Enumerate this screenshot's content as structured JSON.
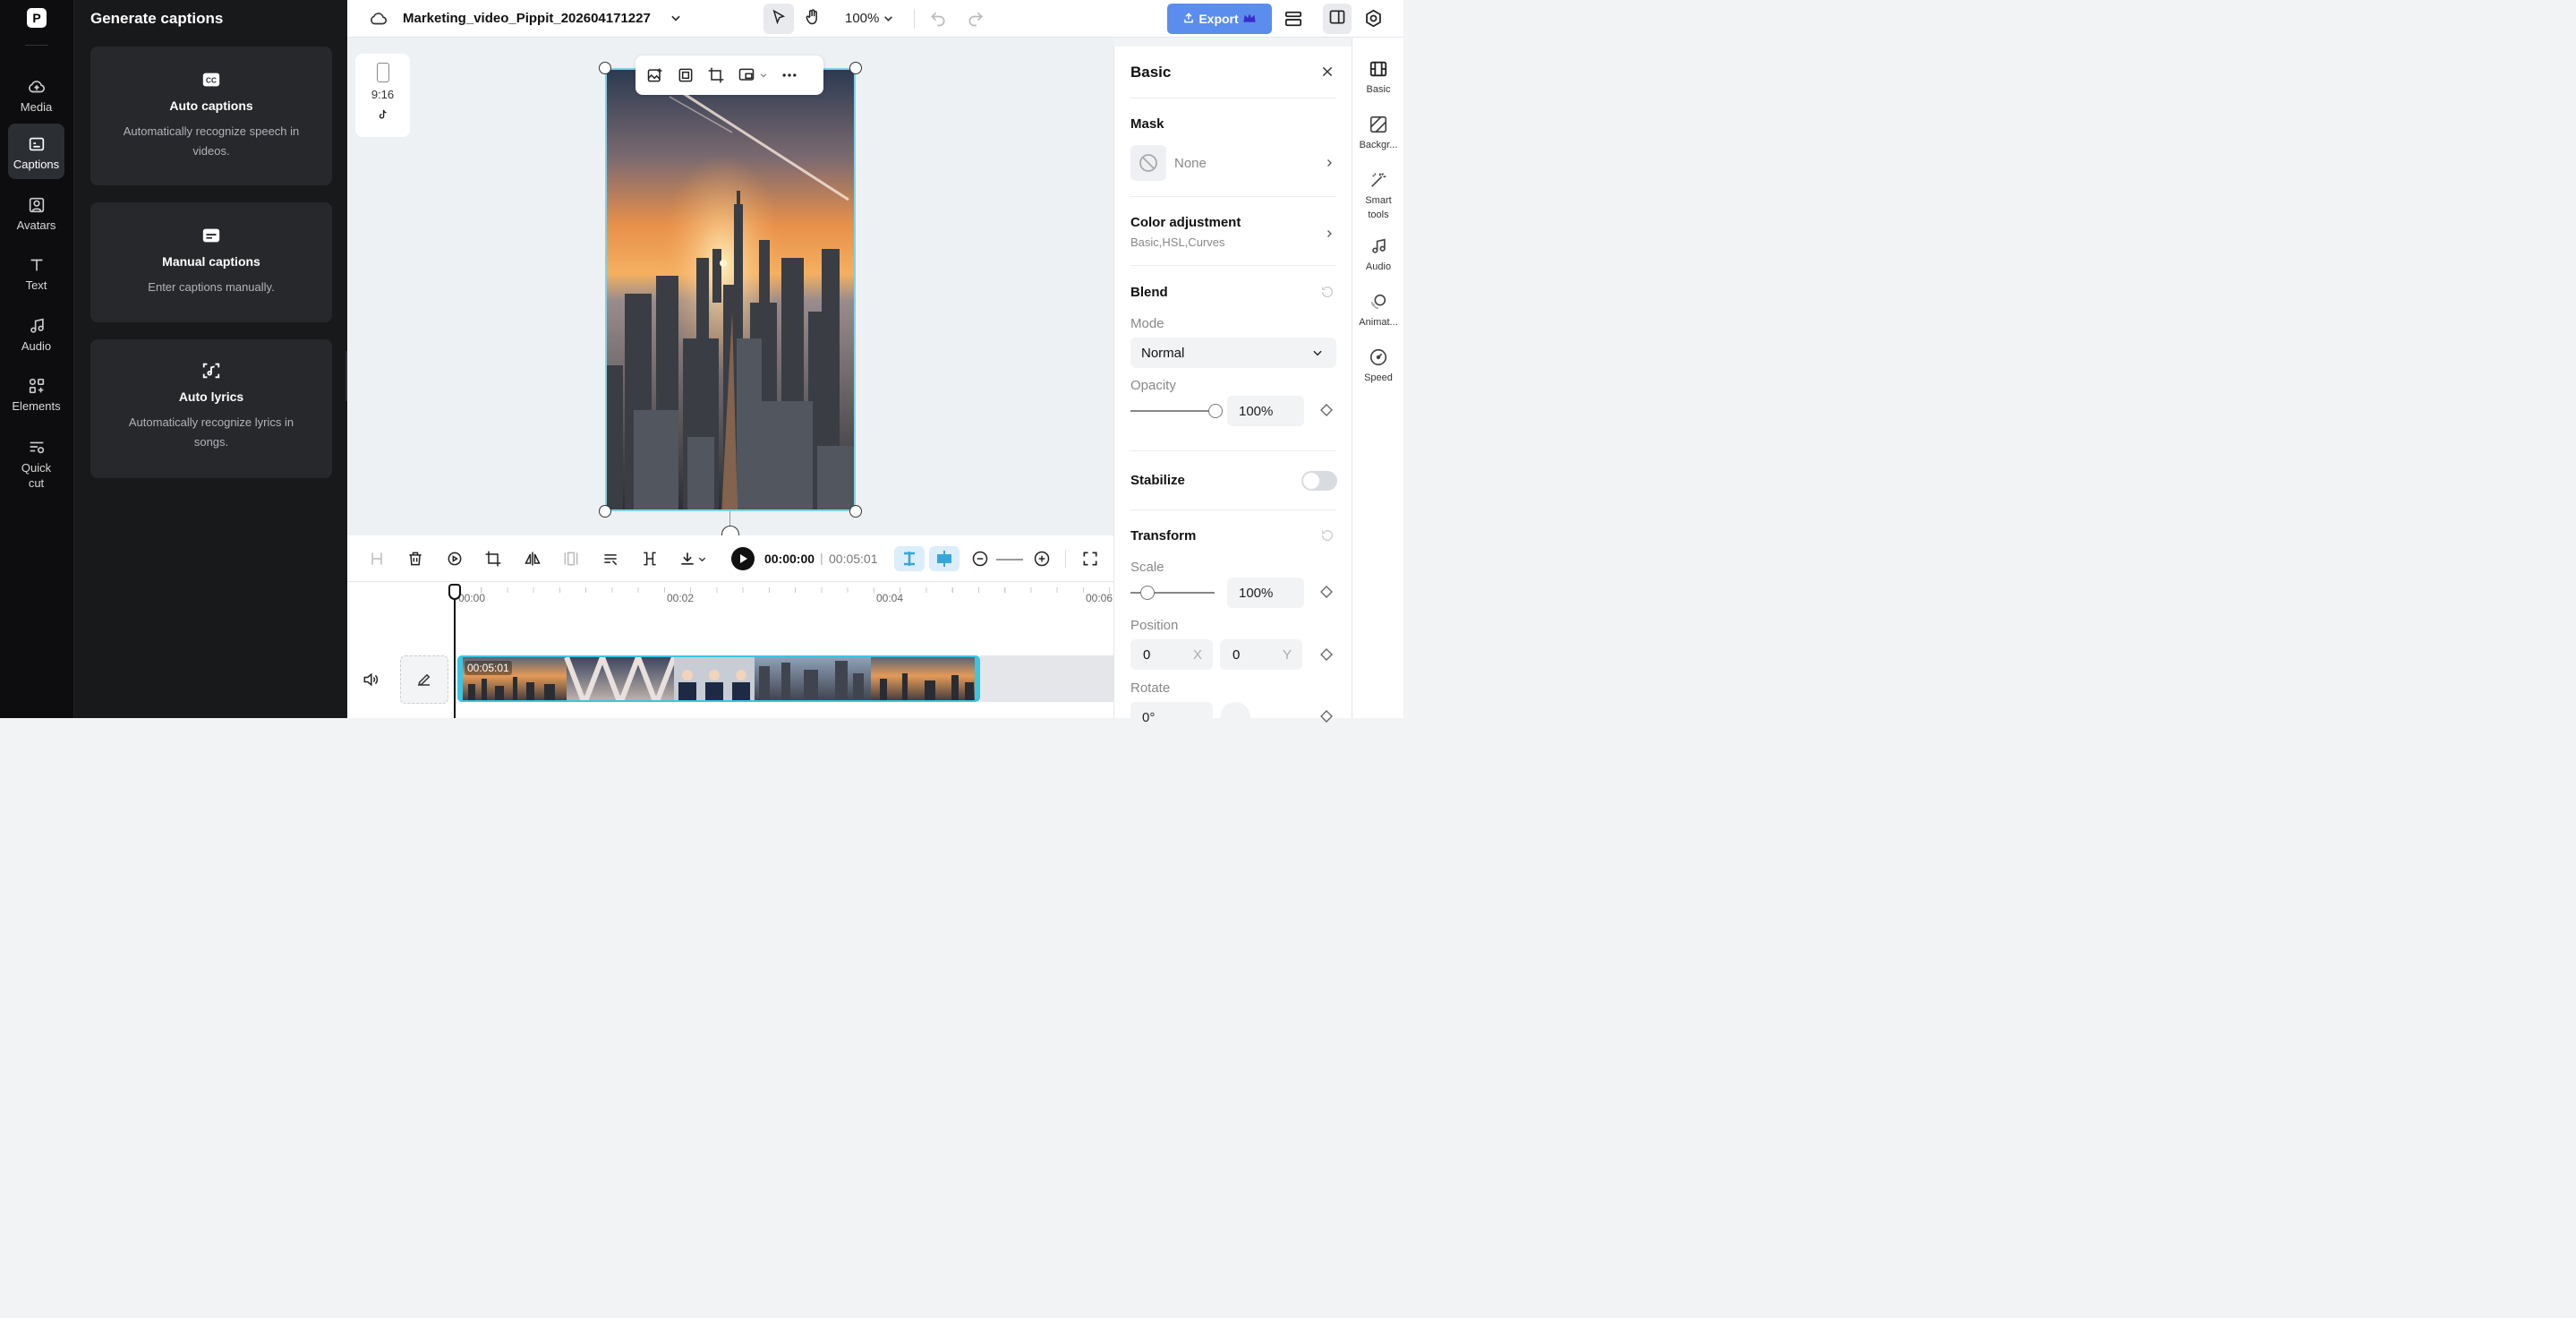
{
  "rail": {
    "items": [
      {
        "label": "Media",
        "icon": "cloud-icon"
      },
      {
        "label": "Captions",
        "icon": "captions-icon",
        "active": true
      },
      {
        "label": "Avatars",
        "icon": "avatar-icon"
      },
      {
        "label": "Text",
        "icon": "text-icon"
      },
      {
        "label": "Audio",
        "icon": "music-note-icon"
      },
      {
        "label": "Elements",
        "icon": "elements-icon"
      },
      {
        "label": "Quick cut",
        "icon": "quick-cut-icon"
      }
    ]
  },
  "captions_panel": {
    "title": "Generate captions",
    "cards": [
      {
        "title": "Auto captions",
        "desc": "Automatically recognize speech in videos.",
        "icon": "cc-icon"
      },
      {
        "title": "Manual captions",
        "desc": "Enter captions manually.",
        "icon": "subtitle-icon"
      },
      {
        "title": "Auto lyrics",
        "desc": "Automatically recognize lyrics in songs.",
        "icon": "lyrics-icon"
      }
    ]
  },
  "topbar": {
    "filename": "Marketing_video_Pippit_202604171227",
    "zoom": "100%",
    "export_label": "Export"
  },
  "canvas": {
    "ratio": "9:16"
  },
  "playback": {
    "current_time": "00:00:00",
    "separator": "|",
    "total_time": "00:05:01"
  },
  "timeline": {
    "ticks": [
      "00:00",
      "00:02",
      "00:04",
      "00:06"
    ],
    "clip_duration": "00:05:01"
  },
  "properties": {
    "title": "Basic",
    "mask_label": "Mask",
    "mask_value": "None",
    "color_adjustment_label": "Color adjustment",
    "color_adjustment_sub": "Basic,HSL,Curves",
    "blend_label": "Blend",
    "mode_label": "Mode",
    "mode_value": "Normal",
    "opacity_label": "Opacity",
    "opacity_value": "100%",
    "opacity_level": 1.0,
    "stabilize_label": "Stabilize",
    "stabilize_on": false,
    "transform_label": "Transform",
    "scale_label": "Scale",
    "scale_value": "100%",
    "position_label": "Position",
    "position_x": "0",
    "position_x_axis": "X",
    "position_y": "0",
    "position_y_axis": "Y",
    "rotate_label": "Rotate",
    "rotate_value": "0°"
  },
  "right_tabs": [
    {
      "label": "Basic",
      "icon": "basic-icon"
    },
    {
      "label": "Backgr...",
      "icon": "background-icon"
    },
    {
      "label": "Smart tools",
      "icon": "magic-wand-icon"
    },
    {
      "label": "Audio",
      "icon": "music-note-icon"
    },
    {
      "label": "Animat...",
      "icon": "animation-icon"
    },
    {
      "label": "Speed",
      "icon": "speed-icon"
    }
  ],
  "colors": {
    "accent": "#5b8def",
    "selection": "#38c6e3",
    "rail_bg": "#0d0d0f",
    "panel_bg": "#18191b"
  }
}
